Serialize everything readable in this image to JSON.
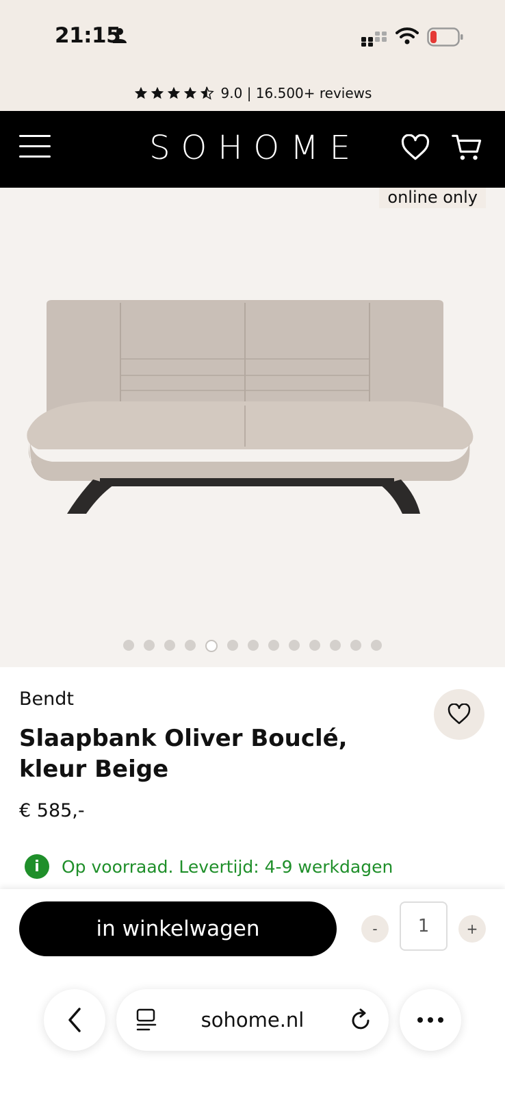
{
  "status": {
    "time": "21:15"
  },
  "reviews": {
    "score_text": "9.0 | 16.500+ reviews",
    "rating": 4.5,
    "max": 5
  },
  "nav": {
    "logo": "SOHOME"
  },
  "gallery": {
    "badge": "online only",
    "image_count": 13,
    "active_index": 4
  },
  "product": {
    "brand": "Bendt",
    "title": "Slaapbank Oliver Bouclé, kleur Beige",
    "price": "€ 585,-",
    "stock_icon": "i",
    "stock_text": "Op voorraad. Levertijd: 4-9 werkdagen"
  },
  "cart": {
    "button_label": "in winkelwagen",
    "minus": "-",
    "plus": "+",
    "quantity": "1"
  },
  "browser": {
    "url": "sohome.nl"
  },
  "colors": {
    "stock_green": "#1f8f2a",
    "accent_beige": "#f2ece6"
  }
}
